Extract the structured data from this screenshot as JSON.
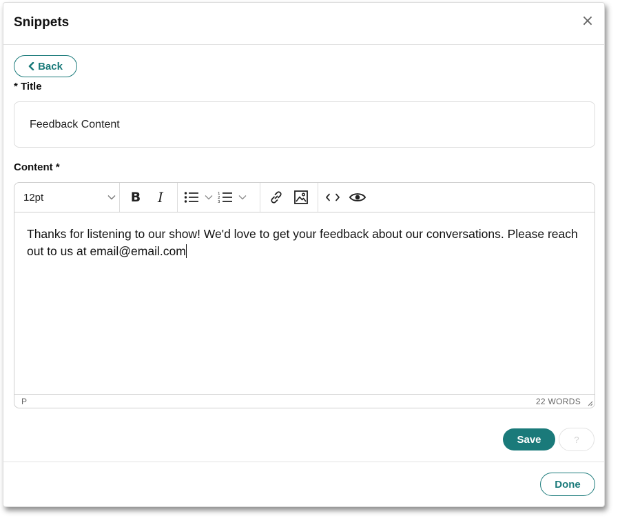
{
  "modal": {
    "title": "Snippets",
    "close_label": "×"
  },
  "back_button": {
    "label": "Back",
    "icon": "chevron-left-icon"
  },
  "form": {
    "title_label": "* Title",
    "title_value": "Feedback Content",
    "content_label": "Content *"
  },
  "editor": {
    "toolbar": {
      "font_size": "12pt",
      "bold_label": "B",
      "italic_label": "I",
      "icons": [
        "chevron-down-icon",
        "bullet-list-icon",
        "numbered-list-icon",
        "link-icon",
        "image-icon",
        "code-icon",
        "eye-icon"
      ]
    },
    "content": "Thanks for listening to our show! We'd love to get your feedback about our conversations. Please reach out to us at email@email.com",
    "status_path": "P",
    "word_count": "22 WORDS"
  },
  "actions": {
    "save_label": "Save",
    "help_label": "?",
    "done_label": "Done"
  },
  "colors": {
    "accent": "#1a7a7a",
    "border": "#dcdcdc",
    "text": "#111111"
  }
}
